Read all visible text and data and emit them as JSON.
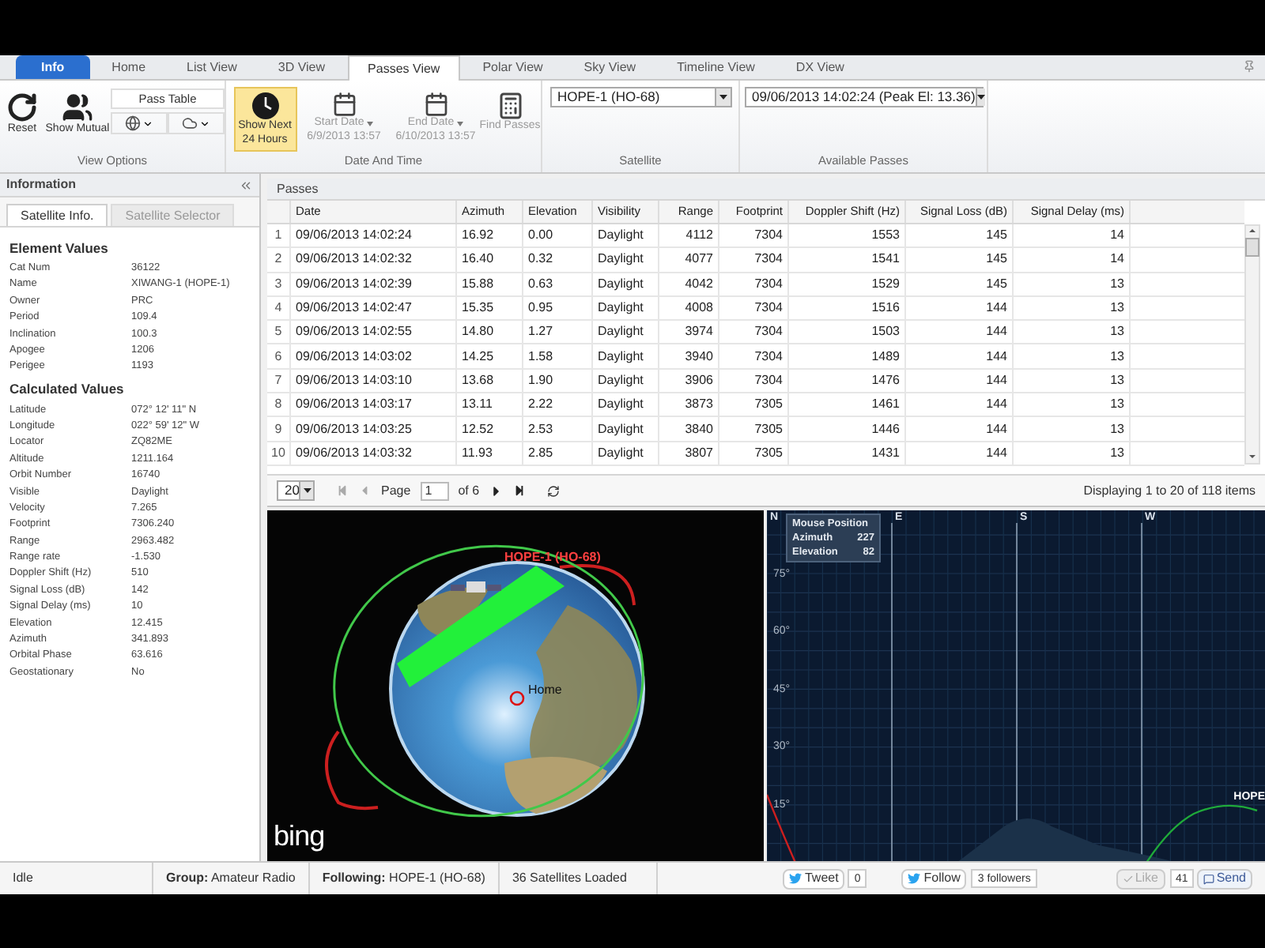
{
  "tabs": [
    {
      "label": "Info",
      "kind": "app",
      "selected": false
    },
    {
      "label": "Home",
      "kind": "tab",
      "selected": false
    },
    {
      "label": "List View",
      "kind": "tab",
      "selected": false
    },
    {
      "label": "3D View",
      "kind": "tab",
      "selected": false
    },
    {
      "label": "Passes View",
      "kind": "tab",
      "selected": true
    },
    {
      "label": "Polar View",
      "kind": "tab",
      "selected": false
    },
    {
      "label": "Sky View",
      "kind": "tab",
      "selected": false
    },
    {
      "label": "Timeline View",
      "kind": "tab",
      "selected": false
    },
    {
      "label": "DX View",
      "kind": "tab",
      "selected": false
    }
  ],
  "view_options": {
    "label": "View Options",
    "reset": "Reset",
    "show_mutual": "Show Mutual",
    "pass_table": "Pass Table"
  },
  "date_and_time": {
    "label": "Date And Time",
    "show_next": {
      "label": "Show Next 24 Hours",
      "on": true
    },
    "start_date": {
      "label": "Start Date",
      "value": "6/9/2013 13:57",
      "disabled": true
    },
    "end_date": {
      "label": "End Date",
      "value": "6/10/2013 13:57",
      "disabled": true
    },
    "find_passes": {
      "label": "Find Passes",
      "disabled": true
    }
  },
  "satellite": {
    "label": "Satellite",
    "value": "HOPE-1 (HO-68)"
  },
  "available_passes": {
    "label": "Available Passes",
    "value": "09/06/2013 14:02:24 (Peak El: 13.36)"
  },
  "info_panel": {
    "title": "Information",
    "tabs": [
      {
        "label": "Satellite Info.",
        "selected": true
      },
      {
        "label": "Satellite Selector",
        "selected": false
      }
    ],
    "sections": [
      {
        "title": "Element Values",
        "rows": [
          {
            "label": "Cat Num",
            "value": "36122"
          },
          {
            "label": "Name",
            "value": "XIWANG-1 (HOPE-1)"
          },
          {
            "label": "Owner",
            "value": "PRC"
          },
          {
            "label": "Period",
            "value": "109.4"
          },
          {
            "label": "Inclination",
            "value": "100.3"
          },
          {
            "label": "Apogee",
            "value": "1206"
          },
          {
            "label": "Perigee",
            "value": "1193"
          }
        ]
      },
      {
        "title": "Calculated Values",
        "rows": [
          {
            "label": "Latitude",
            "value": "072° 12' 11\" N"
          },
          {
            "label": "Longitude",
            "value": "022° 59' 12\" W"
          },
          {
            "label": "Locator",
            "value": "ZQ82ME"
          },
          {
            "label": "Altitude",
            "value": "1211.164"
          },
          {
            "label": "Orbit Number",
            "value": "16740"
          },
          {
            "label": "Visible",
            "value": "Daylight"
          },
          {
            "label": "Velocity",
            "value": "7.265"
          },
          {
            "label": "Footprint",
            "value": "7306.240"
          },
          {
            "label": "Range",
            "value": "2963.482"
          },
          {
            "label": "Range rate",
            "value": "-1.530"
          },
          {
            "label": "Doppler Shift (Hz)",
            "value": "510"
          },
          {
            "label": "Signal Loss (dB)",
            "value": "142"
          },
          {
            "label": "Signal Delay (ms)",
            "value": "10"
          },
          {
            "label": "Elevation",
            "value": "12.415"
          },
          {
            "label": "Azimuth",
            "value": "341.893"
          },
          {
            "label": "Orbital Phase",
            "value": "63.616"
          },
          {
            "label": "Geostationary",
            "value": "No"
          }
        ]
      }
    ]
  },
  "passes": {
    "title": "Passes",
    "columns": [
      "Date",
      "Azimuth",
      "Elevation",
      "Visibility",
      "Range",
      "Footprint",
      "Doppler Shift (Hz)",
      "Signal Loss (dB)",
      "Signal Delay (ms)"
    ],
    "rows": [
      {
        "number": "1",
        "cells": [
          "09/06/2013 14:02:24",
          "16.92",
          "0.00",
          "Daylight",
          "4112",
          "7304",
          "1553",
          "145",
          "14"
        ]
      },
      {
        "number": "2",
        "cells": [
          "09/06/2013 14:02:32",
          "16.40",
          "0.32",
          "Daylight",
          "4077",
          "7304",
          "1541",
          "145",
          "14"
        ]
      },
      {
        "number": "3",
        "cells": [
          "09/06/2013 14:02:39",
          "15.88",
          "0.63",
          "Daylight",
          "4042",
          "7304",
          "1529",
          "145",
          "13"
        ]
      },
      {
        "number": "4",
        "cells": [
          "09/06/2013 14:02:47",
          "15.35",
          "0.95",
          "Daylight",
          "4008",
          "7304",
          "1516",
          "144",
          "13"
        ]
      },
      {
        "number": "5",
        "cells": [
          "09/06/2013 14:02:55",
          "14.80",
          "1.27",
          "Daylight",
          "3974",
          "7304",
          "1503",
          "144",
          "13"
        ]
      },
      {
        "number": "6",
        "cells": [
          "09/06/2013 14:03:02",
          "14.25",
          "1.58",
          "Daylight",
          "3940",
          "7304",
          "1489",
          "144",
          "13"
        ]
      },
      {
        "number": "7",
        "cells": [
          "09/06/2013 14:03:10",
          "13.68",
          "1.90",
          "Daylight",
          "3906",
          "7304",
          "1476",
          "144",
          "13"
        ]
      },
      {
        "number": "8",
        "cells": [
          "09/06/2013 14:03:17",
          "13.11",
          "2.22",
          "Daylight",
          "3873",
          "7305",
          "1461",
          "144",
          "13"
        ]
      },
      {
        "number": "9",
        "cells": [
          "09/06/2013 14:03:25",
          "12.52",
          "2.53",
          "Daylight",
          "3840",
          "7305",
          "1446",
          "144",
          "13"
        ]
      },
      {
        "number": "10",
        "cells": [
          "09/06/2013 14:03:32",
          "11.93",
          "2.85",
          "Daylight",
          "3807",
          "7305",
          "1431",
          "144",
          "13"
        ]
      }
    ],
    "pager": {
      "page_size": "20",
      "page_label": "Page",
      "page": "1",
      "page_count": "of 6",
      "summary": "Displaying 1 to 20 of 118 items"
    }
  },
  "globe_view": {
    "satellite_label": "HOPE-1 (HO-68)",
    "home_label": "Home",
    "logo": "bing"
  },
  "sky_view": {
    "directions": [
      "N",
      "E",
      "S",
      "W"
    ],
    "elevations": [
      "75°",
      "60°",
      "45°",
      "30°",
      "15°"
    ],
    "satellite_label": "HOPE",
    "mouse_position": {
      "title": "Mouse Position",
      "azimuth_label": "Azimuth",
      "azimuth": "227",
      "elevation_label": "Elevation",
      "elevation": "82"
    }
  },
  "status_bar": {
    "state": "Idle",
    "group": "**Group:** Amateur Radio",
    "following": "**Following:** HOPE-1 (HO-68)",
    "loaded": "36 Satellites Loaded",
    "tweet": {
      "label": "Tweet",
      "count": "0"
    },
    "follow": {
      "label": "Follow",
      "count": "3 followers"
    },
    "like": {
      "label": "Like",
      "count": "41",
      "disabled": true
    },
    "send": "Send"
  }
}
